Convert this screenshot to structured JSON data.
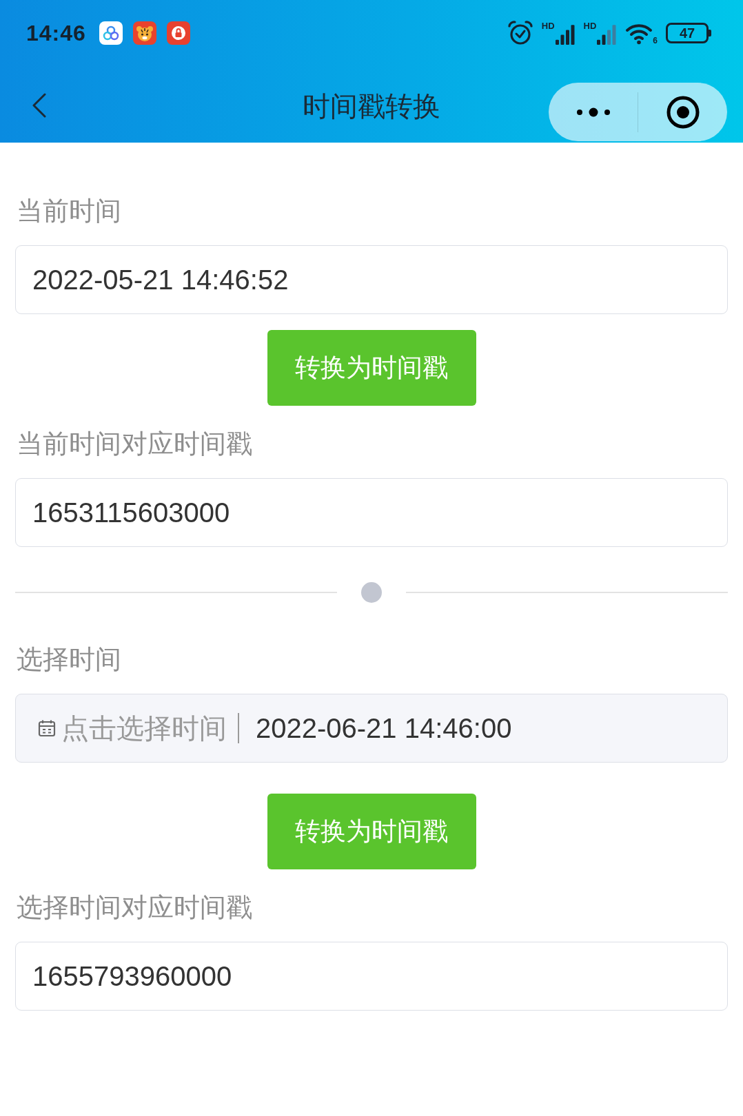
{
  "status_bar": {
    "time": "14:46",
    "signals": [
      {
        "label": "HD"
      },
      {
        "label": "HD"
      }
    ],
    "wifi": {
      "label": "6"
    },
    "battery": "47"
  },
  "nav_bar": {
    "title": "时间戳转换"
  },
  "sections": [
    {
      "kind": "field",
      "label": "当前时间",
      "value": "2022-05-21 14:46:52"
    },
    {
      "kind": "button",
      "label": "转换为时间戳"
    },
    {
      "kind": "field",
      "label": "当前时间对应时间戳",
      "value": "1653115603000"
    },
    {
      "kind": "divider"
    },
    {
      "kind": "picker",
      "label": "选择时间",
      "prompt": "点击选择时间",
      "value": "2022-06-21 14:46:00"
    },
    {
      "kind": "button",
      "label": "转换为时间戳"
    },
    {
      "kind": "field",
      "label": "选择时间对应时间戳",
      "value": "1655793960000"
    }
  ]
}
